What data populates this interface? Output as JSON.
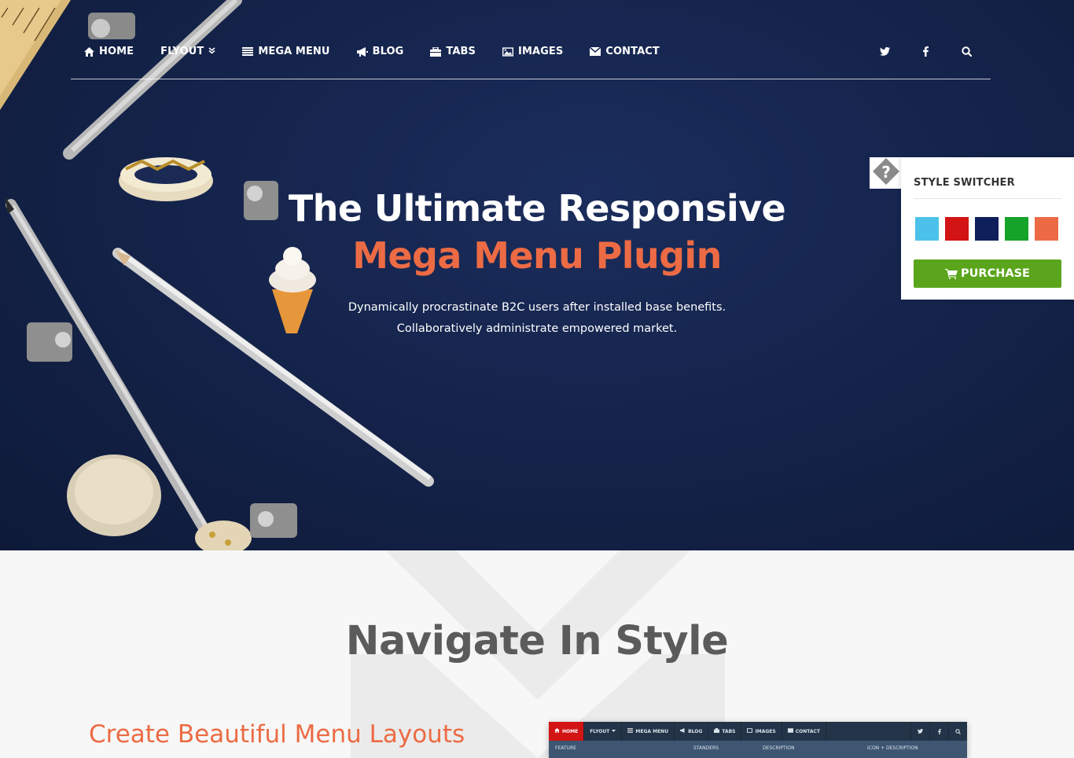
{
  "nav": {
    "items": [
      {
        "label": "HOME",
        "icon": "home-icon"
      },
      {
        "label": "FLYOUT",
        "icon": "",
        "has_dropdown": true
      },
      {
        "label": "MEGA MENU",
        "icon": "list-icon"
      },
      {
        "label": "BLOG",
        "icon": "bullhorn-icon"
      },
      {
        "label": "TABS",
        "icon": "briefcase-icon"
      },
      {
        "label": "IMAGES",
        "icon": "image-icon"
      },
      {
        "label": "CONTACT",
        "icon": "envelope-icon"
      }
    ],
    "social": [
      "twitter-icon",
      "facebook-icon",
      "search-icon"
    ]
  },
  "hero": {
    "title_line1": "The Ultimate Responsive",
    "title_line2": "Mega Menu Plugin",
    "subtitle_line1": "Dynamically procrastinate B2C users after installed base benefits.",
    "subtitle_line2": "Collaboratively administrate empowered market."
  },
  "switcher": {
    "title": "STYLE SWITCHER",
    "swatches": [
      "#4cc2ea",
      "#d21414",
      "#0e1f5c",
      "#16a32a",
      "#ec6b44"
    ],
    "purchase_label": "PURCHASE"
  },
  "section": {
    "title": "Navigate In Style",
    "subtitle": "Create Beautiful Menu Layouts"
  },
  "preview": {
    "nav_items": [
      "HOME",
      "FLYOUT",
      "MEGA MENU",
      "BLOG",
      "TABS",
      "IMAGES",
      "CONTACT"
    ],
    "columns": [
      "FEATURE",
      "STANDERS",
      "DESCRIPTION",
      "ICON + DESCRIPTION"
    ]
  },
  "colors": {
    "accent": "#ec6b44",
    "purchase": "#5ba51c",
    "hero_bg": "#15244c"
  }
}
